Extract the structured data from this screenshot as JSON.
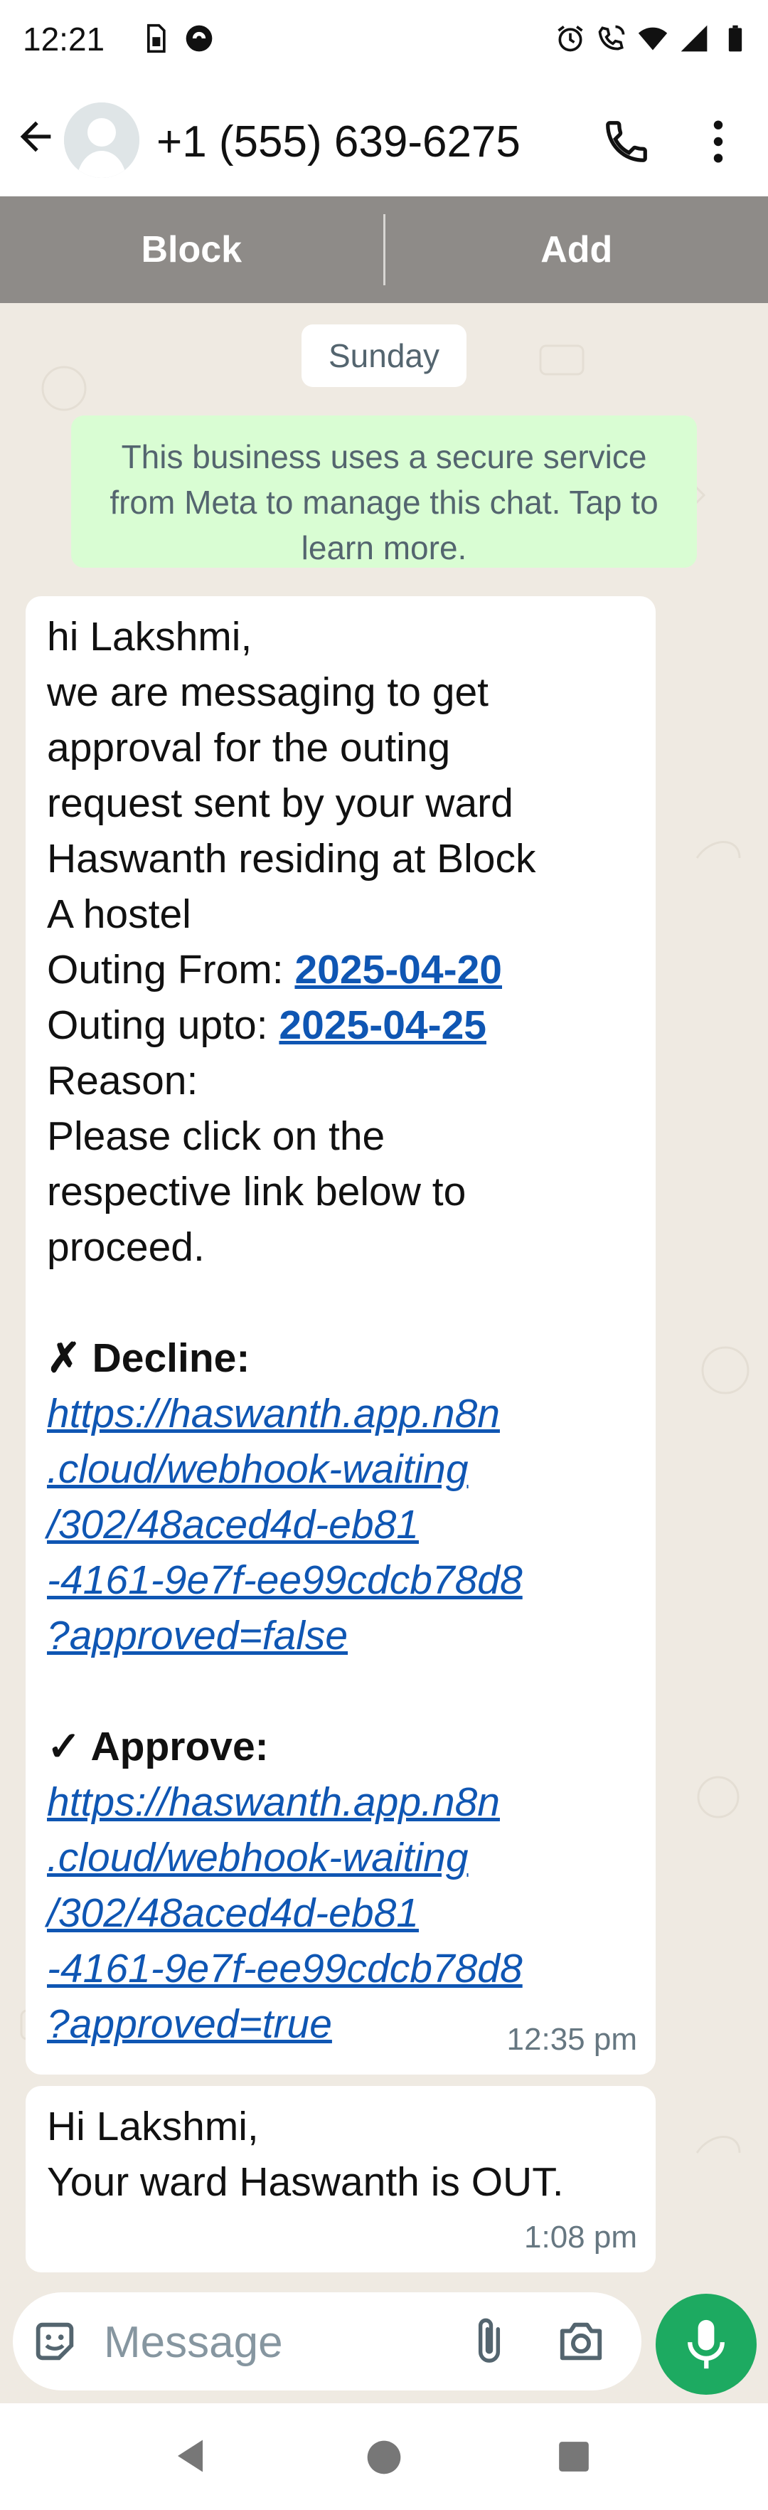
{
  "status_bar": {
    "time": "12:21",
    "left_icons": [
      "sim-card-icon",
      "vpn-icon"
    ],
    "right_icons": [
      "alarm-icon",
      "wifi-calling-icon",
      "wifi-icon",
      "signal-icon",
      "battery-icon"
    ]
  },
  "header": {
    "contact_name": "+1 (555) 639-6275",
    "icons": [
      "back-arrow-icon",
      "avatar",
      "phone-icon",
      "more-vert-icon"
    ]
  },
  "action_bar": {
    "block_label": "Block",
    "add_label": "Add"
  },
  "chat": {
    "date_chip": "Sunday",
    "system_notice": "This business uses a secure service from Meta to manage this chat. Tap to learn more.",
    "messages": [
      {
        "greeting": "hi  Lakshmi,",
        "body_lines": [
          "we are messaging to get",
          "approval for the outing",
          "request sent by your ward",
          "Haswanth  residing at Block",
          "A hostel"
        ],
        "outing_from_label": "Outing From:",
        "outing_from_date": "2025-04-20",
        "outing_upto_label": "Outing upto:",
        "outing_upto_date": "2025-04-25",
        "reason_label": "Reason:",
        "instruction_lines": [
          "Please click on the",
          "respective link below to",
          "proceed."
        ],
        "decline_label": "✗ Decline:",
        "decline_url_lines": [
          "https://haswanth.app.n8n",
          ".cloud/webhook-waiting",
          "/302/48aced4d-eb81",
          "-4161-9e7f-ee99cdcb78d8",
          "?approved=false"
        ],
        "approve_label": "✓ Approve:",
        "approve_url_lines": [
          "https://haswanth.app.n8n",
          ".cloud/webhook-waiting",
          "/302/48aced4d-eb81",
          "-4161-9e7f-ee99cdcb78d8",
          "?approved=true"
        ],
        "time": "12:35 pm"
      },
      {
        "lines": [
          "Hi Lakshmi,",
          "Your ward Haswanth is OUT."
        ],
        "time": "1:08 pm"
      }
    ]
  },
  "composer": {
    "placeholder": "Message",
    "icons": [
      "emoji-icon",
      "attach-icon",
      "camera-icon",
      "mic-icon"
    ]
  },
  "nav_bar": {
    "icons": [
      "nav-back-icon",
      "nav-home-icon",
      "nav-recents-icon"
    ]
  },
  "colors": {
    "accent_green": "#1daa61",
    "link_blue": "#0f56b3",
    "chat_background": "#efeae2",
    "notice_background": "#d9fdd3",
    "action_bar": "#8e8b88"
  }
}
